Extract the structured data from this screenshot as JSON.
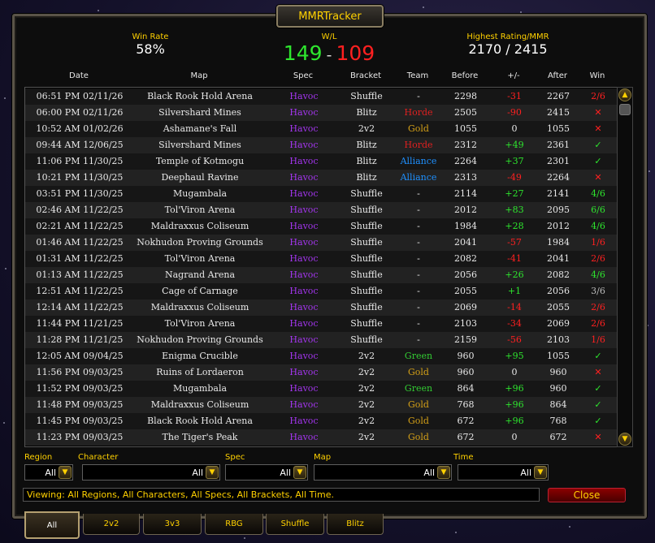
{
  "window": {
    "title": "MMRTracker"
  },
  "stats": {
    "win_rate_label": "Win Rate",
    "win_rate_value": "58%",
    "wl_label": "W/L",
    "wins": "149",
    "separator": "-",
    "losses": "109",
    "highest_label": "Highest Rating/MMR",
    "highest_value": "2170 / 2415"
  },
  "columns": [
    "Date",
    "Map",
    "Spec",
    "Bracket",
    "Team",
    "Before",
    "+/-",
    "After",
    "Win"
  ],
  "rows": [
    {
      "date": "06:51 PM 02/11/26",
      "map": "Black Rook Hold Arena",
      "spec": "Havoc",
      "bracket": "Shuffle",
      "team": "-",
      "before": "2298",
      "diff": "-31",
      "after": "2267",
      "win": "2/6"
    },
    {
      "date": "06:00 PM 02/11/26",
      "map": "Silvershard Mines",
      "spec": "Havoc",
      "bracket": "Blitz",
      "team": "Horde",
      "before": "2505",
      "diff": "-90",
      "after": "2415",
      "win": "✕"
    },
    {
      "date": "10:52 AM 01/02/26",
      "map": "Ashamane's Fall",
      "spec": "Havoc",
      "bracket": "2v2",
      "team": "Gold",
      "before": "1055",
      "diff": "0",
      "after": "1055",
      "win": "✕"
    },
    {
      "date": "09:44 AM 12/06/25",
      "map": "Silvershard Mines",
      "spec": "Havoc",
      "bracket": "Blitz",
      "team": "Horde",
      "before": "2312",
      "diff": "+49",
      "after": "2361",
      "win": "✓"
    },
    {
      "date": "11:06 PM 11/30/25",
      "map": "Temple of Kotmogu",
      "spec": "Havoc",
      "bracket": "Blitz",
      "team": "Alliance",
      "before": "2264",
      "diff": "+37",
      "after": "2301",
      "win": "✓"
    },
    {
      "date": "10:21 PM 11/30/25",
      "map": "Deephaul Ravine",
      "spec": "Havoc",
      "bracket": "Blitz",
      "team": "Alliance",
      "before": "2313",
      "diff": "-49",
      "after": "2264",
      "win": "✕"
    },
    {
      "date": "03:51 PM 11/30/25",
      "map": "Mugambala",
      "spec": "Havoc",
      "bracket": "Shuffle",
      "team": "-",
      "before": "2114",
      "diff": "+27",
      "after": "2141",
      "win": "4/6"
    },
    {
      "date": "02:46 AM 11/22/25",
      "map": "Tol'Viron Arena",
      "spec": "Havoc",
      "bracket": "Shuffle",
      "team": "-",
      "before": "2012",
      "diff": "+83",
      "after": "2095",
      "win": "6/6"
    },
    {
      "date": "02:21 AM 11/22/25",
      "map": "Maldraxxus Coliseum",
      "spec": "Havoc",
      "bracket": "Shuffle",
      "team": "-",
      "before": "1984",
      "diff": "+28",
      "after": "2012",
      "win": "4/6"
    },
    {
      "date": "01:46 AM 11/22/25",
      "map": "Nokhudon Proving Grounds",
      "spec": "Havoc",
      "bracket": "Shuffle",
      "team": "-",
      "before": "2041",
      "diff": "-57",
      "after": "1984",
      "win": "1/6"
    },
    {
      "date": "01:31 AM 11/22/25",
      "map": "Tol'Viron Arena",
      "spec": "Havoc",
      "bracket": "Shuffle",
      "team": "-",
      "before": "2082",
      "diff": "-41",
      "after": "2041",
      "win": "2/6"
    },
    {
      "date": "01:13 AM 11/22/25",
      "map": "Nagrand Arena",
      "spec": "Havoc",
      "bracket": "Shuffle",
      "team": "-",
      "before": "2056",
      "diff": "+26",
      "after": "2082",
      "win": "4/6"
    },
    {
      "date": "12:51 AM 11/22/25",
      "map": "Cage of Carnage",
      "spec": "Havoc",
      "bracket": "Shuffle",
      "team": "-",
      "before": "2055",
      "diff": "+1",
      "after": "2056",
      "win": "3/6"
    },
    {
      "date": "12:14 AM 11/22/25",
      "map": "Maldraxxus Coliseum",
      "spec": "Havoc",
      "bracket": "Shuffle",
      "team": "-",
      "before": "2069",
      "diff": "-14",
      "after": "2055",
      "win": "2/6"
    },
    {
      "date": "11:44 PM 11/21/25",
      "map": "Tol'Viron Arena",
      "spec": "Havoc",
      "bracket": "Shuffle",
      "team": "-",
      "before": "2103",
      "diff": "-34",
      "after": "2069",
      "win": "2/6"
    },
    {
      "date": "11:28 PM 11/21/25",
      "map": "Nokhudon Proving Grounds",
      "spec": "Havoc",
      "bracket": "Shuffle",
      "team": "-",
      "before": "2159",
      "diff": "-56",
      "after": "2103",
      "win": "1/6"
    },
    {
      "date": "12:05 AM 09/04/25",
      "map": "Enigma Crucible",
      "spec": "Havoc",
      "bracket": "2v2",
      "team": "Green",
      "before": "960",
      "diff": "+95",
      "after": "1055",
      "win": "✓"
    },
    {
      "date": "11:56 PM 09/03/25",
      "map": "Ruins of Lordaeron",
      "spec": "Havoc",
      "bracket": "2v2",
      "team": "Gold",
      "before": "960",
      "diff": "0",
      "after": "960",
      "win": "✕"
    },
    {
      "date": "11:52 PM 09/03/25",
      "map": "Mugambala",
      "spec": "Havoc",
      "bracket": "2v2",
      "team": "Green",
      "before": "864",
      "diff": "+96",
      "after": "960",
      "win": "✓"
    },
    {
      "date": "11:48 PM 09/03/25",
      "map": "Maldraxxus Coliseum",
      "spec": "Havoc",
      "bracket": "2v2",
      "team": "Gold",
      "before": "768",
      "diff": "+96",
      "after": "864",
      "win": "✓"
    },
    {
      "date": "11:45 PM 09/03/25",
      "map": "Black Rook Hold Arena",
      "spec": "Havoc",
      "bracket": "2v2",
      "team": "Gold",
      "before": "672",
      "diff": "+96",
      "after": "768",
      "win": "✓"
    },
    {
      "date": "11:23 PM 09/03/25",
      "map": "The Tiger's Peak",
      "spec": "Havoc",
      "bracket": "2v2",
      "team": "Gold",
      "before": "672",
      "diff": "0",
      "after": "672",
      "win": "✕"
    }
  ],
  "filters": {
    "region_label": "Region",
    "region_value": "All",
    "character_label": "Character",
    "character_value": "All",
    "spec_label": "Spec",
    "spec_value": "All",
    "map_label": "Map",
    "map_value": "All",
    "time_label": "Time",
    "time_value": "All"
  },
  "status_text": "Viewing: All Regions, All Characters, All Specs, All Brackets, All Time.",
  "close_label": "Close",
  "tabs": [
    "All",
    "2v2",
    "3v3",
    "RBG",
    "Shuffle",
    "Blitz"
  ],
  "colors": {
    "gold": "#ffd100",
    "win": "#2ee62e",
    "loss": "#ff2020",
    "spec": "#a335ee",
    "horde": "#e02020",
    "alliance": "#1e90ff",
    "team_gold": "#d4a017",
    "team_green": "#33cc33",
    "partial": "#bbbbbb"
  },
  "icons": {
    "dropdown": "chevron-down-icon",
    "scroll_up": "chevron-up-icon",
    "scroll_down": "chevron-down-icon",
    "win": "check-icon",
    "loss": "cross-icon"
  }
}
